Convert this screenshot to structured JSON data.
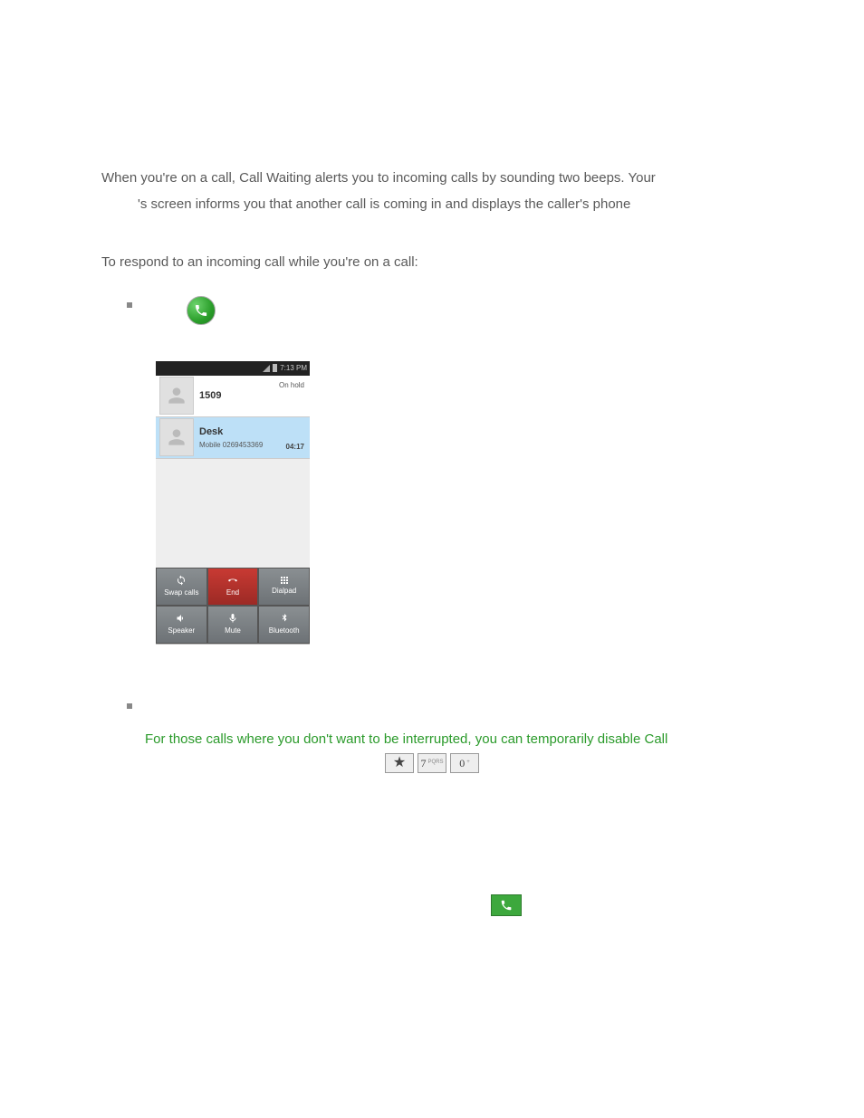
{
  "para1": "When you're on a call, Call Waiting alerts you to incoming calls by sounding two beeps. Your",
  "para1b": "'s screen informs you that another call is coming in and displays the caller's phone",
  "para2": "To respond to an incoming call while you're on a call:",
  "tip": "For those calls where you don't want to be interrupted, you can temporarily disable Call",
  "keys": {
    "star": "★",
    "seven": "7",
    "seven_sub": "PQRS",
    "zero": "0",
    "zero_sub": "+"
  },
  "screenshot": {
    "status_time": "7:13 PM",
    "hold": {
      "name": "1509",
      "status": "On hold"
    },
    "active": {
      "name": "Desk",
      "sub": "Mobile 0269453369",
      "time": "04:17"
    },
    "buttons": {
      "swap": "Swap calls",
      "end": "End",
      "dialpad": "Dialpad",
      "speaker": "Speaker",
      "mute": "Mute",
      "bluetooth": "Bluetooth"
    }
  }
}
